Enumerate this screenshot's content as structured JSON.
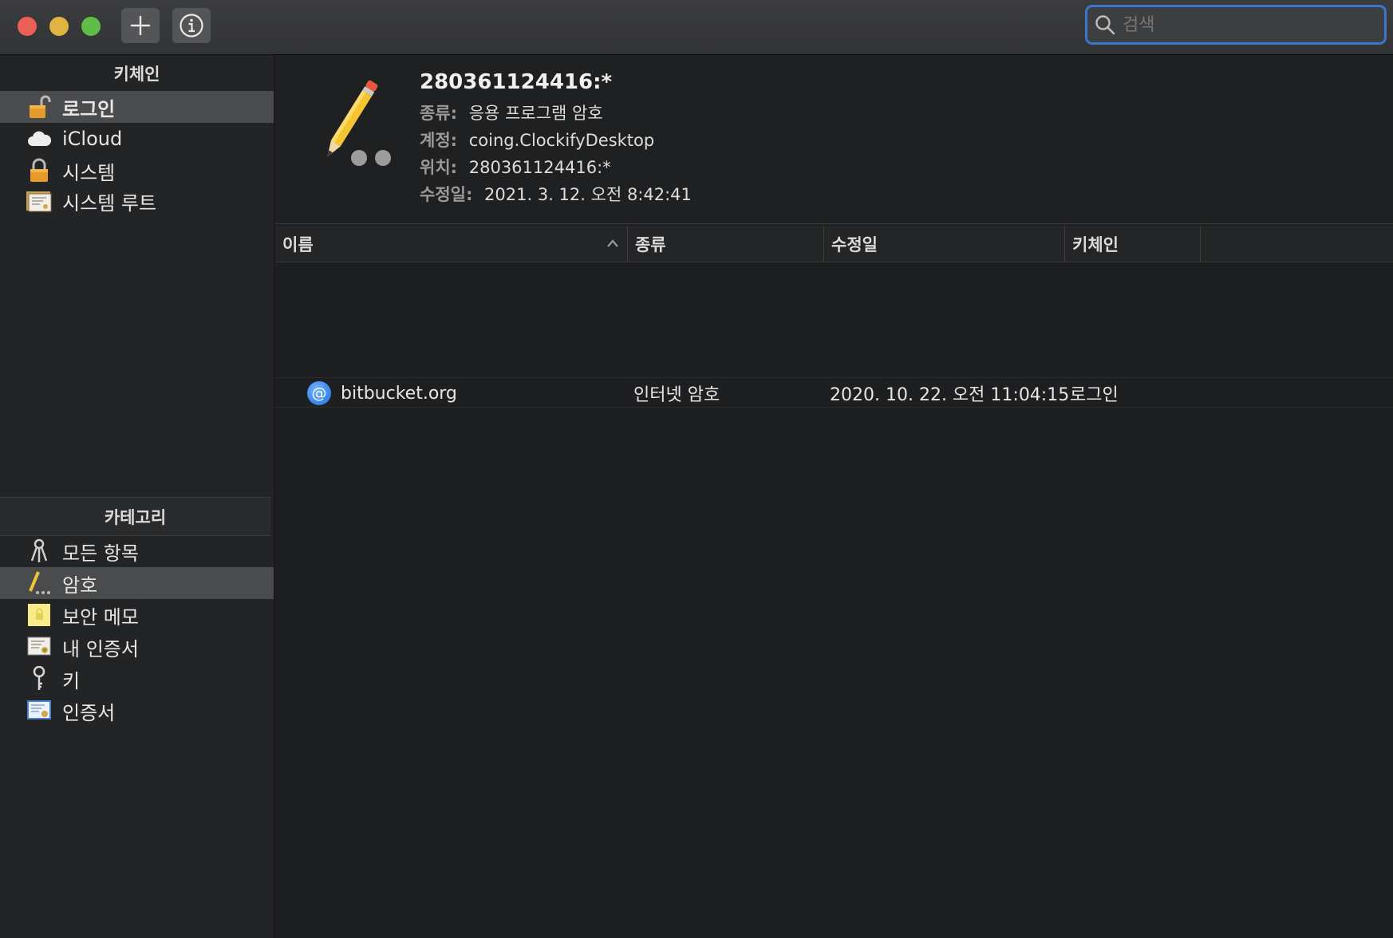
{
  "toolbar": {
    "add_icon": "plus-icon",
    "info_icon": "info-icon",
    "search_placeholder": "검색"
  },
  "sidebar": {
    "keychains_title": "키체인",
    "keychains": [
      {
        "label": "로그인",
        "icon": "unlocked-padlock-icon",
        "selected": true
      },
      {
        "label": "iCloud",
        "icon": "cloud-icon"
      },
      {
        "label": "시스템",
        "icon": "locked-padlock-icon"
      },
      {
        "label": "시스템 루트",
        "icon": "certificate-folder-icon"
      }
    ],
    "categories_title": "카테고리",
    "categories": [
      {
        "label": "모든 항목",
        "icon": "keys-icon"
      },
      {
        "label": "암호",
        "icon": "pencil-password-icon",
        "selected": true
      },
      {
        "label": "보안 메모",
        "icon": "secure-note-icon"
      },
      {
        "label": "내 인증서",
        "icon": "my-certificate-icon"
      },
      {
        "label": "키",
        "icon": "key-icon"
      },
      {
        "label": "인증서",
        "icon": "certificate-icon"
      }
    ]
  },
  "detail": {
    "title": "280361124416:*",
    "kind_label": "종류:",
    "kind_value": "응용 프로그램 암호",
    "account_label": "계정:",
    "account_value": "coing.ClockifyDesktop",
    "where_label": "위치:",
    "where_value": "280361124416:*",
    "modified_label": "수정일:",
    "modified_value": "2021. 3. 12. 오전 8:42:41"
  },
  "table": {
    "columns": [
      "이름",
      "종류",
      "수정일",
      "키체인"
    ],
    "rows": [
      {
        "name": "bitbucket.org",
        "kind": "인터넷 암호",
        "modified": "2020. 10. 22. 오전 11:04:15",
        "keychain": "로그인",
        "icon": "internet-password-at-icon"
      }
    ]
  },
  "colors": {
    "accent": "#3a76c9",
    "selection": "#4a4b4d",
    "background": "#1e1f21"
  }
}
